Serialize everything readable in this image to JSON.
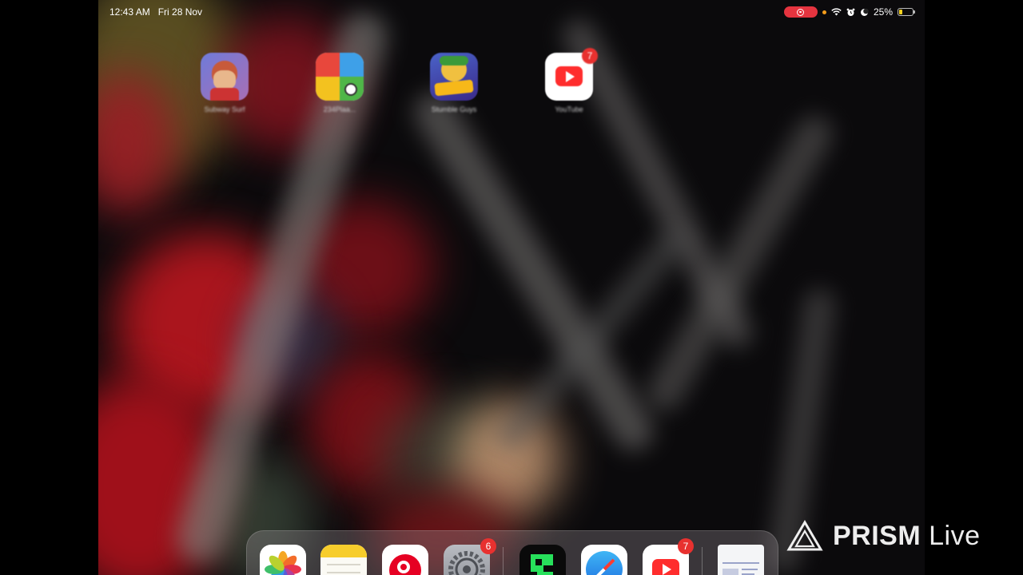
{
  "status_bar": {
    "time": "12:43 AM",
    "date": "Fri 28 Nov",
    "battery_percent": "25%",
    "battery_level": 0.25,
    "icons": [
      "screen-record-icon",
      "wifi-icon",
      "alarm-icon",
      "moon-icon",
      "battery-icon"
    ]
  },
  "home_apps": [
    {
      "label": "Subway Surf",
      "icon": "subway-surf-icon"
    },
    {
      "label": "234Plaa...",
      "icon": "four-quadrant-games-icon"
    },
    {
      "label": "Stumble Guys",
      "icon": "stumble-guys-icon"
    },
    {
      "label": "YouTube",
      "icon": "youtube-icon",
      "badge": "7"
    }
  ],
  "dock": {
    "apps": [
      {
        "name": "Photos",
        "icon": "photos-icon"
      },
      {
        "name": "Notes",
        "icon": "notes-icon"
      },
      {
        "name": "Pinterest",
        "icon": "pinterest-icon"
      },
      {
        "name": "Settings",
        "icon": "settings-icon",
        "badge": "6"
      },
      {
        "name": "Game",
        "icon": "pixel-game-icon"
      },
      {
        "name": "Safari",
        "icon": "safari-icon"
      },
      {
        "name": "YouTube",
        "icon": "youtube-icon",
        "badge": "7"
      },
      {
        "name": "Recent",
        "icon": "document-thumbnail-icon"
      }
    ]
  },
  "watermark": {
    "brand": "PRISM",
    "suffix": "Live"
  },
  "colors": {
    "badge": "#e8312f",
    "youtube": "#ff2d2d",
    "record": "#e5343f",
    "battery": "#f5d21f"
  }
}
